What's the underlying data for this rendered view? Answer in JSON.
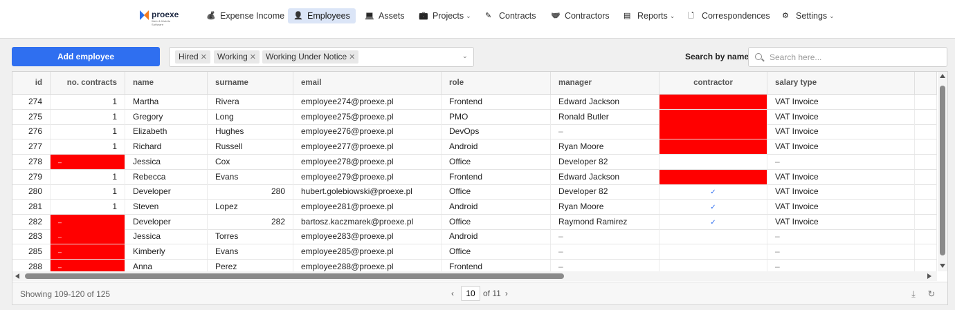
{
  "brand": {
    "name": "proexe",
    "tagline": "Web & Mobile Software"
  },
  "nav": [
    {
      "label": "Expense Income",
      "icon": "money-bag-icon",
      "active": false,
      "dropdown": false
    },
    {
      "label": "Employees",
      "icon": "person-icon",
      "active": true,
      "dropdown": false
    },
    {
      "label": "Assets",
      "icon": "laptop-icon",
      "active": false,
      "dropdown": false
    },
    {
      "label": "Projects",
      "icon": "briefcase-icon",
      "active": false,
      "dropdown": true
    },
    {
      "label": "Contracts",
      "icon": "edit-icon",
      "active": false,
      "dropdown": false
    },
    {
      "label": "Contractors",
      "icon": "handshake-icon",
      "active": false,
      "dropdown": false
    },
    {
      "label": "Reports",
      "icon": "report-icon",
      "active": false,
      "dropdown": true
    },
    {
      "label": "Correspondences",
      "icon": "document-search-icon",
      "active": false,
      "dropdown": false
    },
    {
      "label": "Settings",
      "icon": "gear-icon",
      "active": false,
      "dropdown": true
    }
  ],
  "toolbar": {
    "add_label": "Add employee",
    "filters": [
      "Hired",
      "Working",
      "Working Under Notice"
    ],
    "search_label": "Search by name",
    "search_placeholder": "Search here...",
    "search_value": ""
  },
  "colors": {
    "accent": "#2f6ff0",
    "active_nav": "#dbe5f7",
    "highlight": "#ff0000"
  },
  "table": {
    "columns": [
      "id",
      "no. contracts",
      "name",
      "surname",
      "email",
      "role",
      "manager",
      "contractor",
      "salary type"
    ],
    "rows": [
      {
        "id": "274",
        "contracts": "1",
        "name": "Martha",
        "surname": "Rivera",
        "email": "employee274@proexe.pl",
        "role": "Frontend",
        "manager": "Edward Jackson",
        "contractor": "red",
        "salary": "VAT Invoice"
      },
      {
        "id": "275",
        "contracts": "1",
        "name": "Gregory",
        "surname": "Long",
        "email": "employee275@proexe.pl",
        "role": "PMO",
        "manager": "Ronald Butler",
        "contractor": "red",
        "salary": "VAT Invoice"
      },
      {
        "id": "276",
        "contracts": "1",
        "name": "Elizabeth",
        "surname": "Hughes",
        "email": "employee276@proexe.pl",
        "role": "DevOps",
        "manager": "–",
        "contractor": "red",
        "salary": "VAT Invoice"
      },
      {
        "id": "277",
        "contracts": "1",
        "name": "Richard",
        "surname": "Russell",
        "email": "employee277@proexe.pl",
        "role": "Android",
        "manager": "Ryan Moore",
        "contractor": "red",
        "salary": "VAT Invoice"
      },
      {
        "id": "278",
        "contracts": "red",
        "name": "Jessica",
        "surname": "Cox",
        "email": "employee278@proexe.pl",
        "role": "Office",
        "manager": "Developer 82",
        "contractor": "",
        "salary": "–"
      },
      {
        "id": "279",
        "contracts": "1",
        "name": "Rebecca",
        "surname": "Evans",
        "email": "employee279@proexe.pl",
        "role": "Frontend",
        "manager": "Edward Jackson",
        "contractor": "red",
        "salary": "VAT Invoice"
      },
      {
        "id": "280",
        "contracts": "1",
        "name": "Developer",
        "surname": "280",
        "email": "hubert.golebiowski@proexe.pl",
        "role": "Office",
        "manager": "Developer 82",
        "contractor": "check",
        "salary": "VAT Invoice"
      },
      {
        "id": "281",
        "contracts": "1",
        "name": "Steven",
        "surname": "Lopez",
        "email": "employee281@proexe.pl",
        "role": "Android",
        "manager": "Ryan Moore",
        "contractor": "check",
        "salary": "VAT Invoice"
      },
      {
        "id": "282",
        "contracts": "red",
        "name": "Developer",
        "surname": "282",
        "email": "bartosz.kaczmarek@proexe.pl",
        "role": "Office",
        "manager": "Raymond Ramirez",
        "contractor": "check",
        "salary": "VAT Invoice"
      },
      {
        "id": "283",
        "contracts": "red",
        "name": "Jessica",
        "surname": "Torres",
        "email": "employee283@proexe.pl",
        "role": "Android",
        "manager": "–",
        "contractor": "",
        "salary": "–"
      },
      {
        "id": "285",
        "contracts": "red",
        "name": "Kimberly",
        "surname": "Evans",
        "email": "employee285@proexe.pl",
        "role": "Office",
        "manager": "–",
        "contractor": "",
        "salary": "–"
      },
      {
        "id": "288",
        "contracts": "red",
        "name": "Anna",
        "surname": "Perez",
        "email": "employee288@proexe.pl",
        "role": "Frontend",
        "manager": "–",
        "contractor": "",
        "salary": "–"
      }
    ],
    "dash": "–",
    "check": "✓"
  },
  "footer": {
    "showing": "Showing 109-120 of 125",
    "page": "10",
    "of_pages": "of 11"
  }
}
